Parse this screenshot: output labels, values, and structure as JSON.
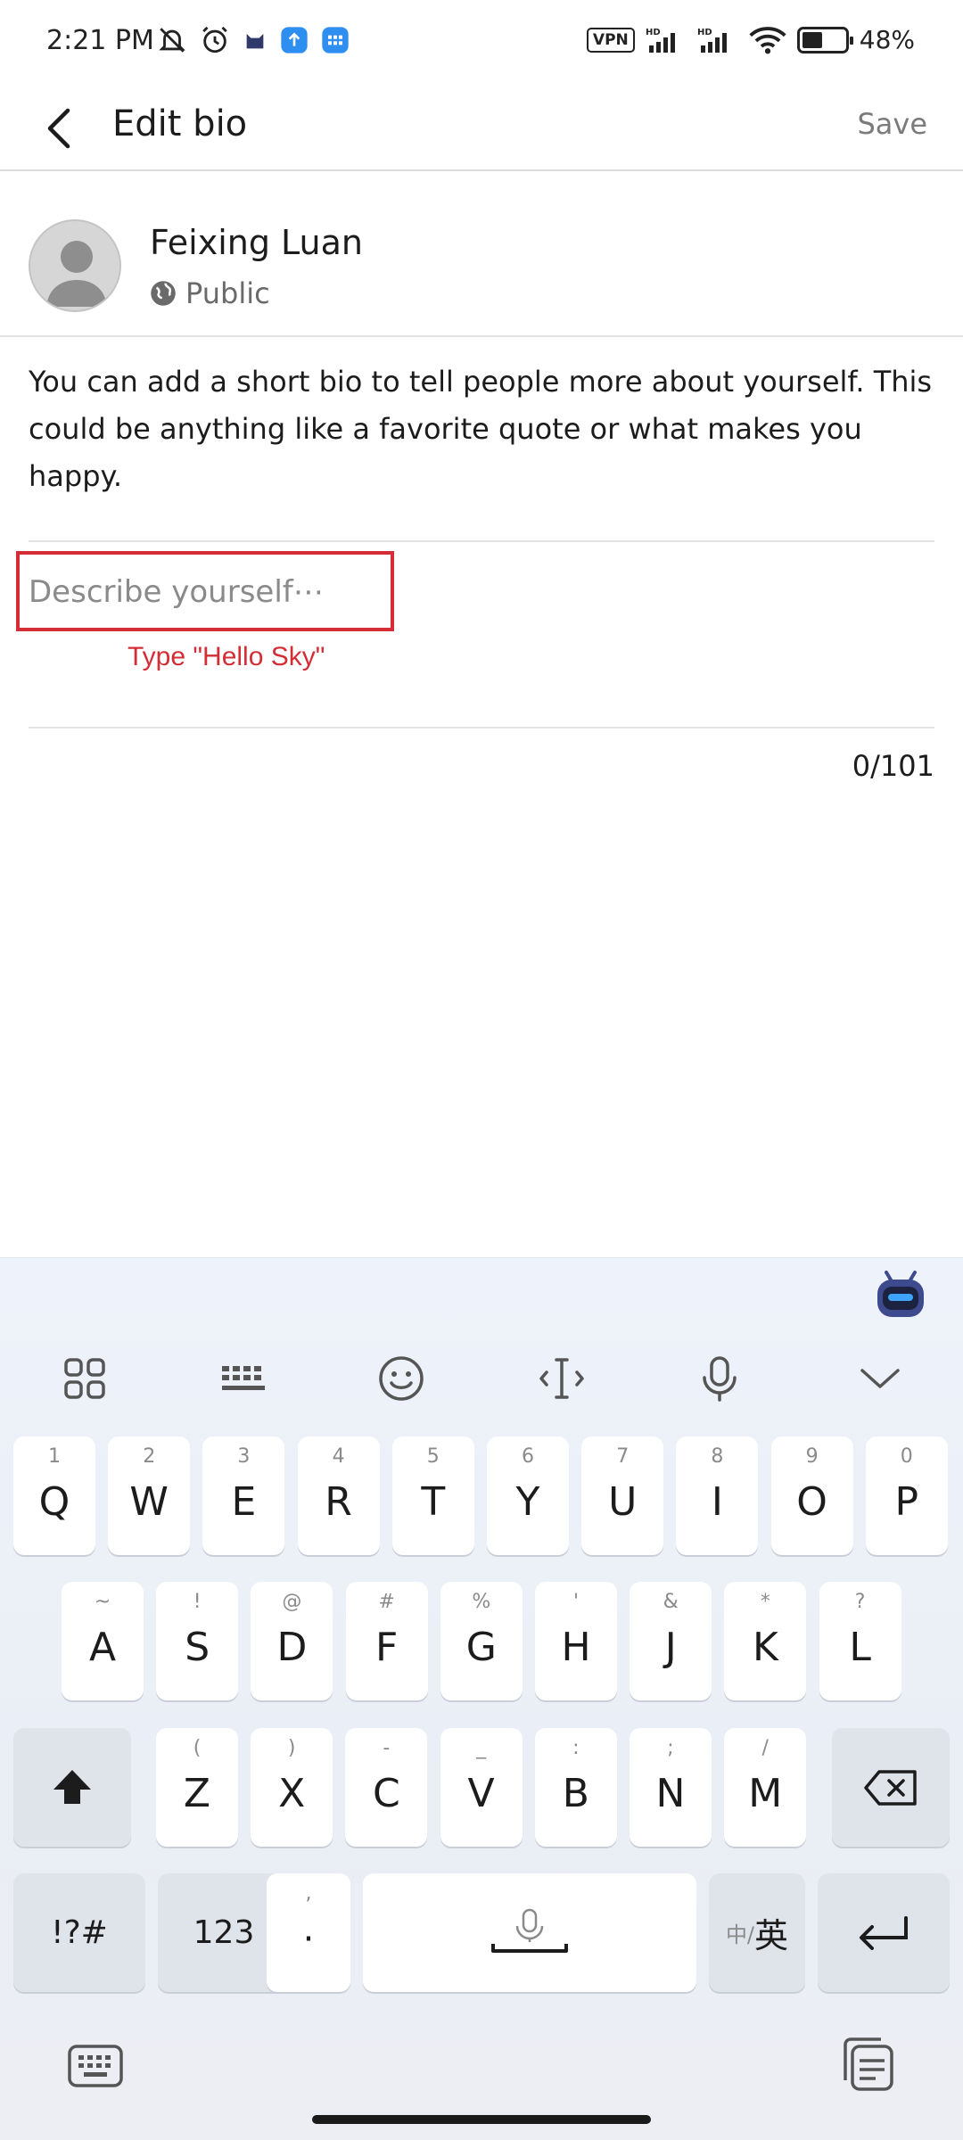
{
  "status_bar": {
    "time": "2:21 PM",
    "vpn": "VPN",
    "battery": "48%",
    "battery_level": 0.48
  },
  "header": {
    "title": "Edit bio",
    "save_label": "Save"
  },
  "profile": {
    "name": "Feixing Luan",
    "privacy": "Public"
  },
  "bio_help": "You can add a short bio to tell people more about yourself. This could be anything like a favorite quote or what makes you happy.",
  "bio_input": {
    "placeholder": "Describe yourself⋯",
    "value": "",
    "char_count": "0/101"
  },
  "annotation": "Type \"Hello Sky\"",
  "keyboard": {
    "row1": [
      {
        "main": "Q",
        "sub": "1"
      },
      {
        "main": "W",
        "sub": "2"
      },
      {
        "main": "E",
        "sub": "3"
      },
      {
        "main": "R",
        "sub": "4"
      },
      {
        "main": "T",
        "sub": "5"
      },
      {
        "main": "Y",
        "sub": "6"
      },
      {
        "main": "U",
        "sub": "7"
      },
      {
        "main": "I",
        "sub": "8"
      },
      {
        "main": "O",
        "sub": "9"
      },
      {
        "main": "P",
        "sub": "0"
      }
    ],
    "row2": [
      {
        "main": "A",
        "sub": "~"
      },
      {
        "main": "S",
        "sub": "!"
      },
      {
        "main": "D",
        "sub": "@"
      },
      {
        "main": "F",
        "sub": "#"
      },
      {
        "main": "G",
        "sub": "%"
      },
      {
        "main": "H",
        "sub": "'"
      },
      {
        "main": "J",
        "sub": "&"
      },
      {
        "main": "K",
        "sub": "*"
      },
      {
        "main": "L",
        "sub": "?"
      }
    ],
    "row3": [
      {
        "main": "Z",
        "sub": "("
      },
      {
        "main": "X",
        "sub": ")"
      },
      {
        "main": "C",
        "sub": "-"
      },
      {
        "main": "V",
        "sub": "_"
      },
      {
        "main": "B",
        "sub": ":"
      },
      {
        "main": "N",
        "sub": ";"
      },
      {
        "main": "M",
        "sub": "/"
      }
    ],
    "symbols_label": "!?#",
    "numbers_label": "123",
    "punct_main": "·",
    "punct_sub": ",",
    "lang_small": "中/",
    "lang_big": "英"
  }
}
